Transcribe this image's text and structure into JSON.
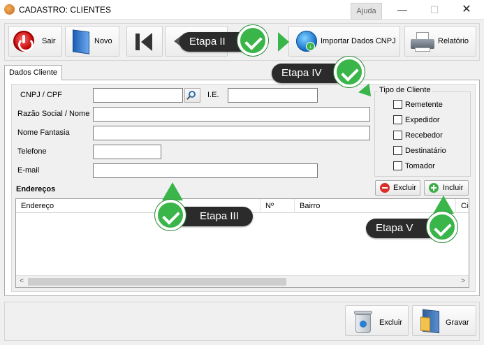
{
  "window": {
    "title": "CADASTRO: CLIENTES",
    "help_label": "Ajuda",
    "minimize_glyph": "—",
    "maximize_glyph": "☐",
    "close_glyph": "✕"
  },
  "toolbar": {
    "exit_label": "Sair",
    "new_label": "Novo",
    "import_label": "Importar Dados CNPJ",
    "report_label": "Relatório"
  },
  "tab": {
    "label": "Dados Cliente"
  },
  "form": {
    "cnpj_label": "CNPJ / CPF",
    "cnpj_value": "",
    "ie_label": "I.E.",
    "ie_value": "",
    "razao_label": "Razão Social / Nome",
    "razao_value": "",
    "fantasia_label": "Nome Fantasia",
    "fantasia_value": "",
    "telefone_label": "Telefone",
    "telefone_value": "",
    "email_label": "E-mail",
    "email_value": ""
  },
  "tipo_cliente": {
    "legend": "Tipo de Cliente",
    "options": [
      {
        "label": "Remetente",
        "checked": false
      },
      {
        "label": "Expedidor",
        "checked": false
      },
      {
        "label": "Recebedor",
        "checked": false
      },
      {
        "label": "Destinatário",
        "checked": false
      },
      {
        "label": "Tomador",
        "checked": false
      }
    ]
  },
  "enderecos": {
    "title": "Endereços",
    "remove_label": "Excluir",
    "add_label": "Incluir",
    "columns": [
      "Endereço",
      "Nº",
      "Bairro",
      "Cid"
    ],
    "rows": []
  },
  "bottom": {
    "delete_label": "Excluir",
    "save_label": "Gravar"
  },
  "callouts": {
    "etapa2": "Etapa II",
    "etapa3": "Etapa III",
    "etapa4": "Etapa IV",
    "etapa5": "Etapa V"
  },
  "colors": {
    "callout_bg": "#2b2b2b",
    "check_green": "#3ab54a"
  }
}
